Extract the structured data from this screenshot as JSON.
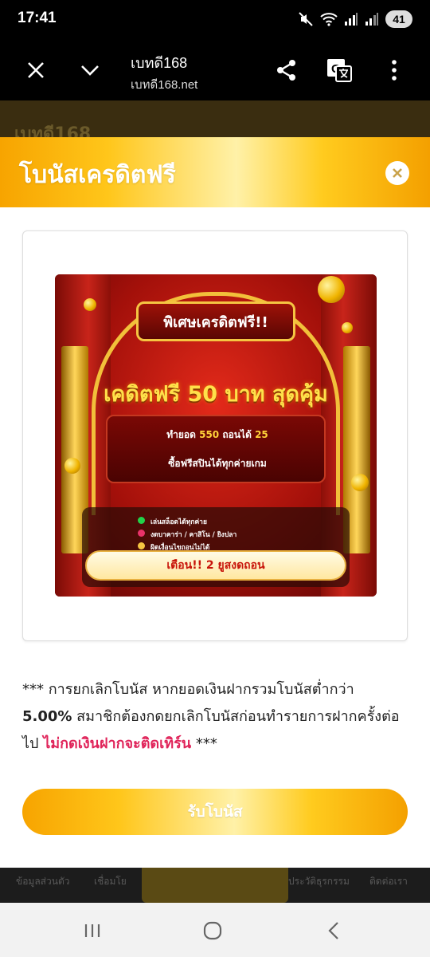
{
  "status_bar": {
    "time": "17:41",
    "battery": "41"
  },
  "browser": {
    "page_title": "เบทดี168",
    "url": "เบทดี168.net"
  },
  "background_page": {
    "header": "เบทดี168",
    "nav": [
      "ข้อมูลส่วนตัว",
      "เชื่อมโย",
      "ประวัติธุรกรรม",
      "ติดต่อเรา"
    ]
  },
  "modal": {
    "title": "โบนัสเครดิตฟรี",
    "banner": {
      "tag": "พิเศษเครดิตฟรี!!",
      "headline": "เคดิตฟรี 50 บาท สุดคุ้ม",
      "turnover_prefix": "ทำยอด",
      "turnover_amount": "550",
      "turnover_middle": "ถอนได้",
      "withdraw_amount": "25",
      "line2": "ซื้อฟรีสปินได้ทุกค่ายเกม",
      "features": [
        "เล่นสล็อตได้ทุกค่าย",
        "งดบาคาร่า / คาสิโน / ยิงปลา",
        "ผิดเงื่อนไขถอนไม่ได้"
      ],
      "warning": "เตือน!! 2 ยูสงดถอน"
    },
    "notice": {
      "part1": "*** การยกเลิกโบนัส หากยอดเงินฝากรวมโบนัสต่ำกว่า ",
      "percent": "5.00%",
      "part2": " สมาชิกต้องกดยกเลิกโบนัสก่อนทำรายการฝากครั้งต่อไป ",
      "warning": "ไม่กดเงินฝากจะติดเทิร์น",
      "part3": " ***"
    },
    "claim_button": "รับโบนัส"
  },
  "colors": {
    "accent_gold": "#ffc61a",
    "warning_pink": "#e0245a"
  }
}
